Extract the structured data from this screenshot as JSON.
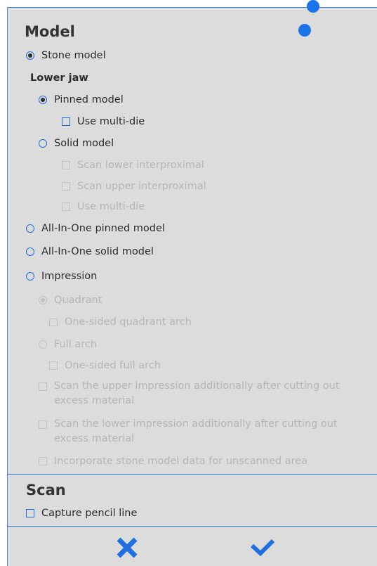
{
  "colors": {
    "accent": "#1f6fe0",
    "panel_bg": "#dcdcdc",
    "disabled_text": "#b5b5b5"
  },
  "model": {
    "title": "Model",
    "stone_model": "Stone model",
    "lower_jaw": "Lower jaw",
    "pinned_model": "Pinned model",
    "use_multi_die": "Use multi-die",
    "solid_model": "Solid model",
    "scan_lower_interproximal": "Scan lower interproximal",
    "scan_upper_interproximal": "Scan upper interproximal",
    "use_multi_die_2": "Use multi-die",
    "all_in_one_pinned": "All-In-One pinned model",
    "all_in_one_solid": "All-In-One solid model",
    "impression": "Impression",
    "quadrant": "Quadrant",
    "one_sided_quadrant": "One-sided quadrant arch",
    "full_arch": "Full arch",
    "one_sided_full": "One-sided full arch",
    "scan_upper_impression": "Scan the upper impression additionally after cutting out excess material",
    "scan_lower_impression": "Scan the lower impression additionally after cutting out excess material",
    "incorporate_stone": "Incorporate stone model data for unscanned area"
  },
  "scan": {
    "title": "Scan",
    "capture_pencil_line": "Capture pencil line"
  },
  "footer": {
    "cancel_icon": "close-icon",
    "confirm_icon": "check-icon"
  }
}
